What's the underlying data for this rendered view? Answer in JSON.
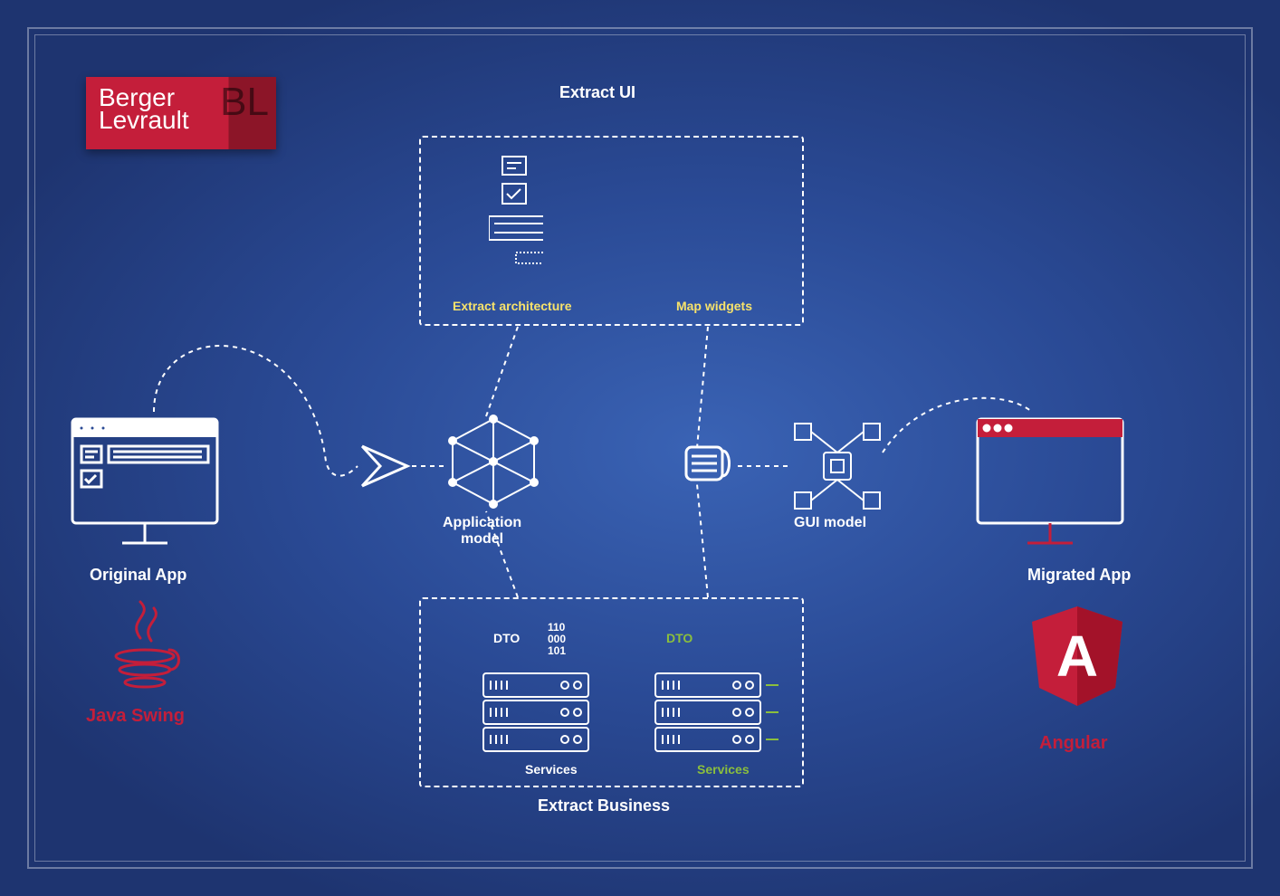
{
  "logo": {
    "line1": "Berger",
    "line2": "Levrault",
    "mono": "BL"
  },
  "titles": {
    "extract_ui": "Extract UI",
    "extract_business": "Extract Business"
  },
  "ui_box": {
    "label_left": "Extract architecture",
    "label_right": "Map widgets"
  },
  "business_box": {
    "left": {
      "dto": "DTO",
      "binary": "110\n000\n101",
      "services": "Services"
    },
    "right": {
      "dto": "DTO",
      "services": "Services"
    }
  },
  "nodes": {
    "original_app": "Original App",
    "migrated_app": "Migrated App",
    "original_tech": "Java Swing",
    "migrated_tech": "Angular",
    "app_model": "Application\nmodel",
    "gui_model": "GUI model",
    "angular_letter": "A"
  }
}
